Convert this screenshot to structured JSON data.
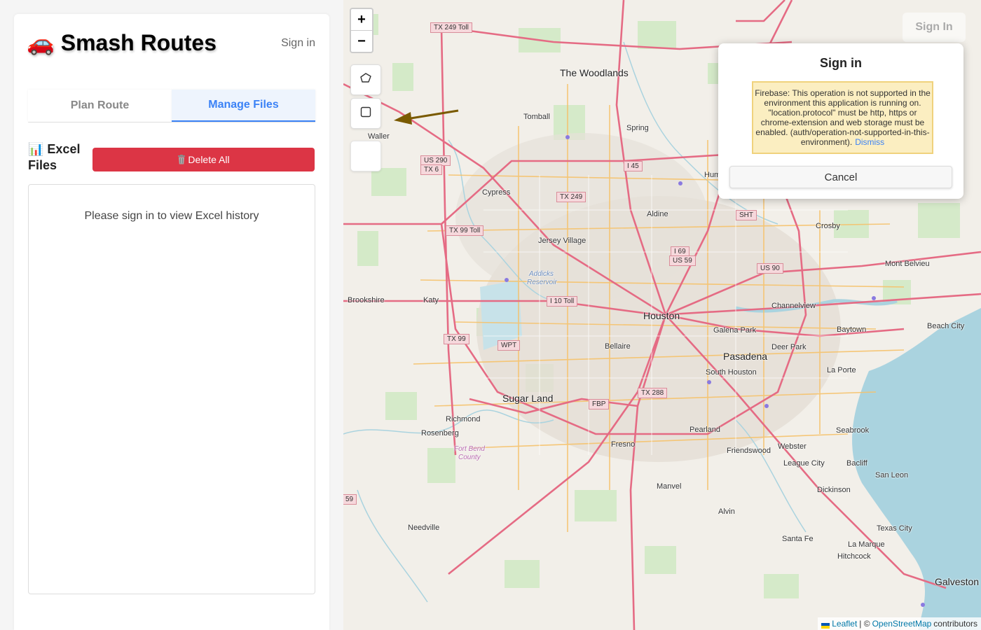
{
  "sidebar": {
    "title": "🚗 Smash Routes",
    "sign_in": "Sign in",
    "tabs": [
      {
        "label": "Plan Route",
        "active": false
      },
      {
        "label": "Manage Files",
        "active": true
      }
    ],
    "files_heading": "📊 Excel Files",
    "delete_all": "Delete All",
    "empty_message": "Please sign in to view Excel history"
  },
  "map": {
    "zoom_in": "+",
    "zoom_out": "−",
    "draw_tools": [
      "polygon-draw-icon",
      "rectangle-draw-icon",
      "blank-tool"
    ],
    "ghost_sign_in": "Sign In",
    "places": [
      {
        "name": "The Woodlands",
        "big": false
      },
      {
        "name": "Tomball"
      },
      {
        "name": "Spring"
      },
      {
        "name": "Waller"
      },
      {
        "name": "Cypress"
      },
      {
        "name": "Aldine"
      },
      {
        "name": "Crosby"
      },
      {
        "name": "Jersey Village"
      },
      {
        "name": "Mont Belvieu"
      },
      {
        "name": "Brookshire"
      },
      {
        "name": "Katy"
      },
      {
        "name": "Houston"
      },
      {
        "name": "Channelview"
      },
      {
        "name": "Galena Park"
      },
      {
        "name": "Baytown"
      },
      {
        "name": "Beach City"
      },
      {
        "name": "Deer Park"
      },
      {
        "name": "Bellaire"
      },
      {
        "name": "Pasadena"
      },
      {
        "name": "South Houston"
      },
      {
        "name": "La Porte"
      },
      {
        "name": "Sugar Land"
      },
      {
        "name": "Richmond"
      },
      {
        "name": "Rosenberg"
      },
      {
        "name": "Seabrook"
      },
      {
        "name": "Pearland"
      },
      {
        "name": "Fresno"
      },
      {
        "name": "Friendswood"
      },
      {
        "name": "Webster"
      },
      {
        "name": "League City"
      },
      {
        "name": "Bacliff"
      },
      {
        "name": "San Leon"
      },
      {
        "name": "Manvel"
      },
      {
        "name": "Dickinson"
      },
      {
        "name": "Alvin"
      },
      {
        "name": "Needville"
      },
      {
        "name": "Santa Fe"
      },
      {
        "name": "Texas City"
      },
      {
        "name": "La Marque"
      },
      {
        "name": "Hitchcock"
      },
      {
        "name": "Galveston"
      },
      {
        "name": "Hum"
      }
    ],
    "water_labels": [
      "Addicks",
      "Reservoir"
    ],
    "county_labels": [
      "Fort Bend",
      "County"
    ],
    "shields": [
      "TX 249 Toll",
      "US 290",
      "TX 6",
      "I 45",
      "TX 249",
      "TX 99 Toll",
      "SHT",
      "I 69",
      "US 59",
      "US 90",
      "I 10 Toll",
      "TX 99",
      "WPT",
      "TX 288",
      "FBP",
      "59"
    ],
    "attribution": {
      "leaflet": "Leaflet",
      "separator": "| ©",
      "osm": "OpenStreetMap",
      "suffix": "contributors"
    }
  },
  "modal": {
    "title": "Sign in",
    "error": "Firebase: This operation is not supported in the environment this application is running on. \"location.protocol\" must be http, https or chrome-extension and web storage must be enabled. (auth/operation-not-supported-in-this-environment).",
    "dismiss": "Dismiss",
    "cancel": "Cancel"
  },
  "colors": {
    "accent": "#3b82f6",
    "danger": "#dc3545",
    "error_bg": "#fbeec1",
    "map_bg": "#f2efe9",
    "highway": "#e56b84",
    "arterial": "#f6c26b",
    "water": "#aad3df"
  }
}
